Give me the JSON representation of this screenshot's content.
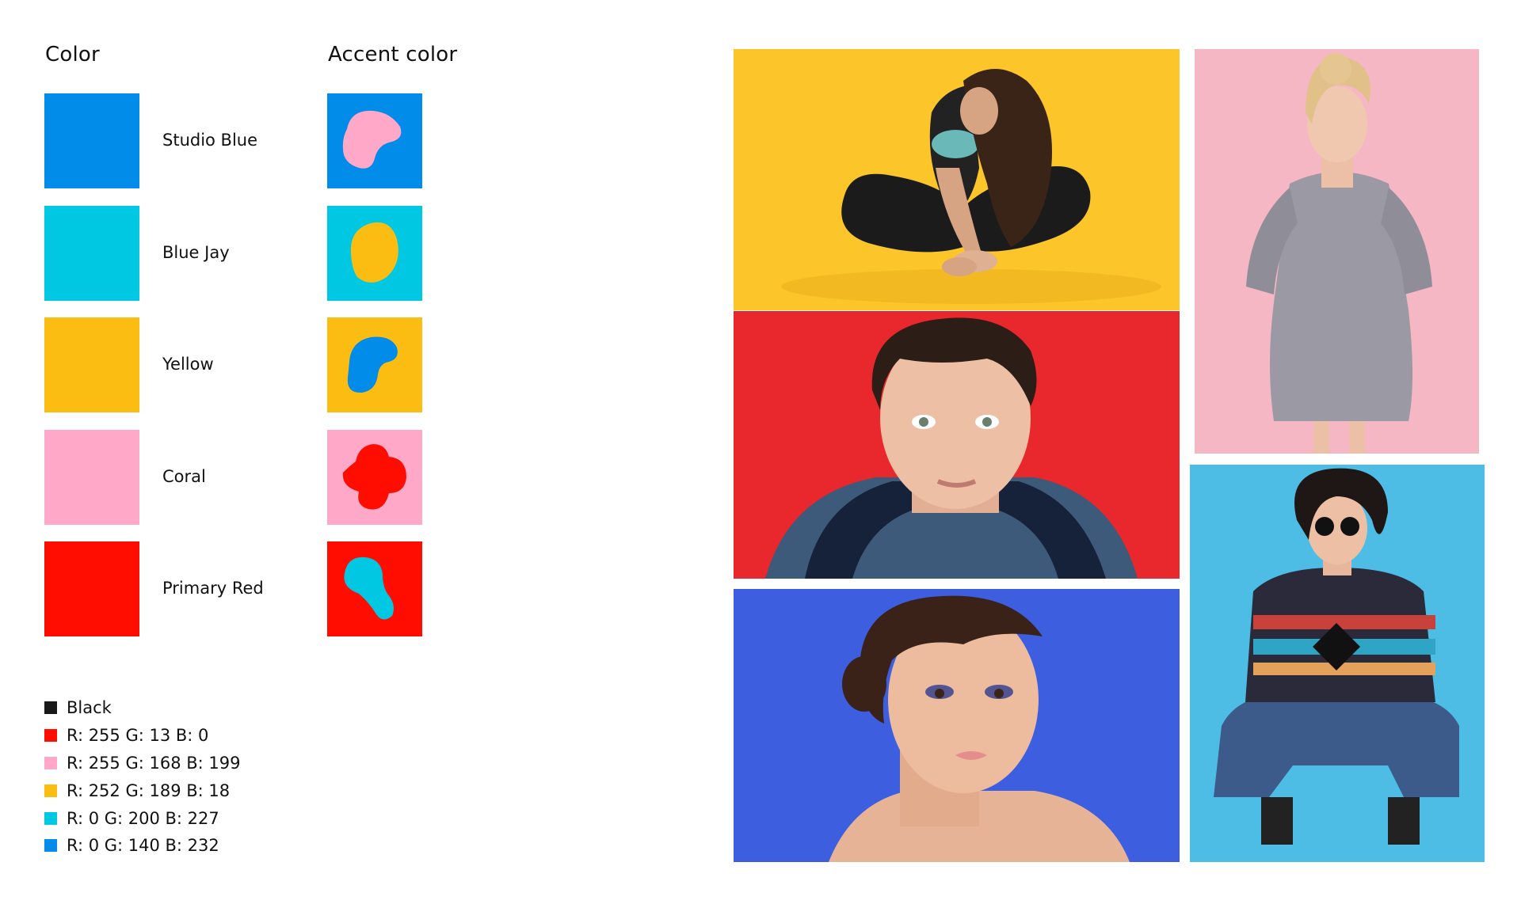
{
  "headings": {
    "color": "Color",
    "accent": "Accent color"
  },
  "swatches": [
    {
      "label": "Studio Blue",
      "color": "#008CE8",
      "accent_color": "#FFA8C7"
    },
    {
      "label": "Blue Jay",
      "color": "#00C8E3",
      "accent_color": "#FCBD12"
    },
    {
      "label": "Yellow",
      "color": "#FCBD12",
      "accent_color": "#008CE8"
    },
    {
      "label": "Coral",
      "color": "#FFA8C7",
      "accent_color": "#FF0D00"
    },
    {
      "label": "Primary Red",
      "color": "#FF0D00",
      "accent_color": "#00C8E3"
    }
  ],
  "legend": [
    {
      "label": "Black",
      "color": "#1A1A1A"
    },
    {
      "label": "R: 255 G: 13 B: 0",
      "color": "#FF0D00"
    },
    {
      "label": "R: 255 G: 168 B: 199",
      "color": "#FFA8C7"
    },
    {
      "label": "R: 252 G: 189 B: 18",
      "color": "#FCBD12"
    },
    {
      "label": "R: 0 G: 200 B: 227",
      "color": "#00C8E3"
    },
    {
      "label": "R: 0 G: 140 B: 232",
      "color": "#008CE8"
    }
  ],
  "photos": [
    {
      "subject": "woman-stretching-yoga",
      "background": "#FCC52A"
    },
    {
      "subject": "young-man-portrait-hoodie",
      "background": "#E8282C"
    },
    {
      "subject": "woman-beauty-portrait",
      "background": "#3E5EE0"
    },
    {
      "subject": "woman-gray-dress-standing",
      "background": "#F5B7C3"
    },
    {
      "subject": "woman-sunglasses-sweater-crouching",
      "background": "#4DBDE6"
    }
  ]
}
